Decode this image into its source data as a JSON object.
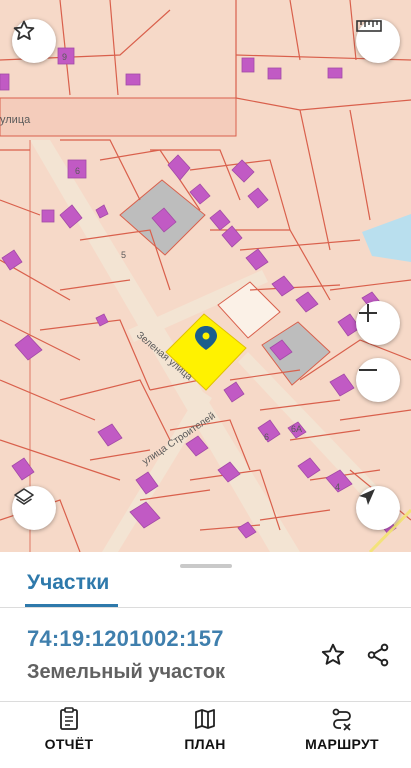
{
  "map": {
    "street_top": "улица",
    "street_zelenaya": "Зеленая улица",
    "street_stroiteley": "улица Строителей",
    "house_numbers": [
      "9",
      "6",
      "5",
      "6",
      "6А",
      "4"
    ]
  },
  "sheet": {
    "tab_label": "Участки",
    "cadastral_number": "74:19:1201002:157",
    "object_type": "Земельный участок"
  },
  "actions": {
    "report_label": "ОТЧЁТ",
    "plan_label": "ПЛАН",
    "route_label": "МАРШРУТ"
  },
  "colors": {
    "accent": "#2e79ab",
    "selected_parcel": "#fff200",
    "parcel_border": "#d9604c",
    "building": "#c15ac4",
    "road": "#f3e4d3"
  }
}
